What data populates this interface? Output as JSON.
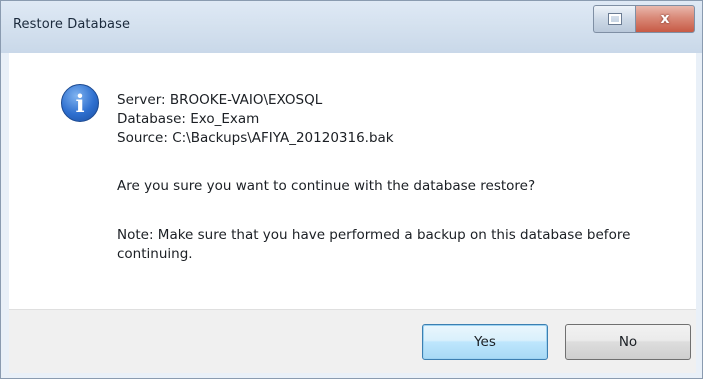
{
  "window": {
    "title": "Restore Database",
    "close_glyph": "x"
  },
  "message": {
    "icon": "info-icon",
    "icon_glyph": "i",
    "server_line": "Server: BROOKE-VAIO\\EXOSQL",
    "database_line": "Database: Exo_Exam",
    "source_line": "Source: C:\\Backups\\AFIYA_20120316.bak",
    "question": "Are you sure you want to continue with the database restore?",
    "note": "Note: Make sure that you have performed a backup on this database before continuing."
  },
  "buttons": {
    "yes_label": "Yes",
    "no_label": "No"
  },
  "colors": {
    "accent_button_border": "#3c7fb1",
    "close_button": "#c75a45",
    "info_icon": "#2e6fcf"
  }
}
